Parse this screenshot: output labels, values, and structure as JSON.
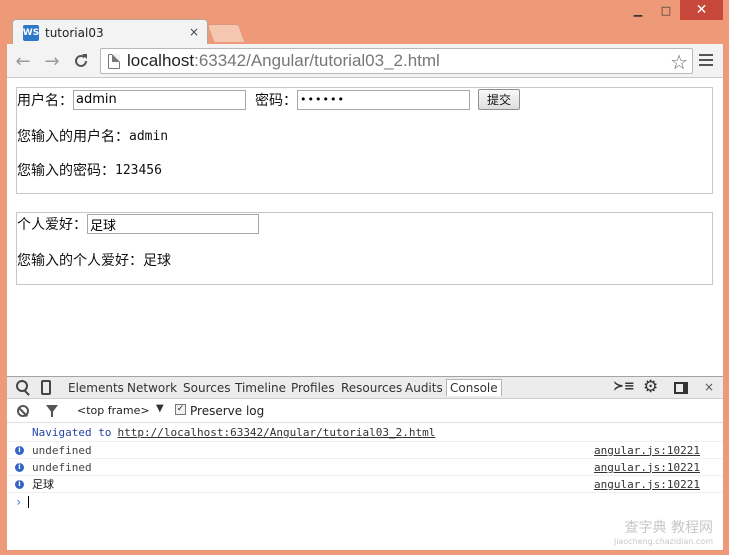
{
  "window": {
    "minimize_glyph": "▁",
    "maximize_glyph": "□",
    "close_glyph": "✕"
  },
  "tab": {
    "icon_text": "WS",
    "title": "tutorial03",
    "close_glyph": "×"
  },
  "toolbar": {
    "url_host": "localhost",
    "url_path": ":63342/Angular/tutorial03_2.html",
    "back_glyph": "←",
    "forward_glyph": "→",
    "reload_glyph": "C",
    "star_glyph": "☆"
  },
  "login_form": {
    "username_label": "用户名：",
    "username_value": "admin",
    "password_label": "密码：",
    "password_value": "••••••",
    "submit_label": "提交",
    "echo_username_label": "您输入的用户名：",
    "echo_username_value": "admin",
    "echo_password_label": "您输入的密码：",
    "echo_password_value": "123456"
  },
  "hobby_form": {
    "hobby_label": "个人爱好：",
    "hobby_value": "足球",
    "echo_hobby_label": "您输入的个人爱好：",
    "echo_hobby_value": "足球"
  },
  "devtools": {
    "tabs": [
      "Elements",
      "Network",
      "Sources",
      "Timeline",
      "Profiles",
      "Resources",
      "Audits",
      "Console"
    ],
    "drawer_glyph": "≻≡",
    "gear_glyph": "⚙",
    "close_glyph": "×",
    "frame_label": "<top frame>",
    "frame_arrow": "▼",
    "preserve_check": "✓",
    "preserve_label": "Preserve log",
    "nav_prefix": "Navigated to",
    "nav_url": "http://localhost:63342/Angular/tutorial03_2.html",
    "messages": [
      {
        "text": "undefined",
        "source": "angular.js:10221"
      },
      {
        "text": "undefined",
        "source": "angular.js:10221"
      },
      {
        "text": "足球",
        "source": "angular.js:10221"
      }
    ],
    "prompt_glyph": "›",
    "info_glyph": "i"
  },
  "watermark": {
    "main": "查字典 教程网",
    "sub": "jiaocheng.chazidian.com"
  },
  "colors": {
    "frame": "#ee9a78",
    "close_button": "#c7473b",
    "console_link": "#2646a7",
    "info_icon": "#3465c6"
  }
}
